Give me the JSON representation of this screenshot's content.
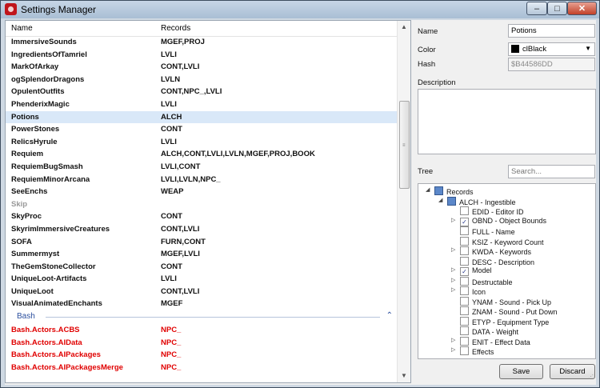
{
  "window": {
    "title": "Settings Manager",
    "controls": {
      "minimize": "–",
      "maximize": "□",
      "close": "✕"
    }
  },
  "list": {
    "columns": {
      "name": "Name",
      "records": "Records"
    },
    "rows": [
      {
        "name": "ImmersiveSounds",
        "records": "MGEF,PROJ",
        "style": "normal"
      },
      {
        "name": "IngredientsOfTamriel",
        "records": "LVLI",
        "style": "normal"
      },
      {
        "name": "MarkOfArkay",
        "records": "CONT,LVLI",
        "style": "normal"
      },
      {
        "name": "ogSplendorDragons",
        "records": "LVLN",
        "style": "normal"
      },
      {
        "name": "OpulentOutfits",
        "records": "CONT,NPC_,LVLI",
        "style": "normal"
      },
      {
        "name": "PhenderixMagic",
        "records": "LVLI",
        "style": "normal"
      },
      {
        "name": "Potions",
        "records": "ALCH",
        "style": "selected"
      },
      {
        "name": "PowerStones",
        "records": "CONT",
        "style": "normal"
      },
      {
        "name": "RelicsHyrule",
        "records": "LVLI",
        "style": "normal"
      },
      {
        "name": "Requiem",
        "records": "ALCH,CONT,LVLI,LVLN,MGEF,PROJ,BOOK",
        "style": "normal"
      },
      {
        "name": "RequiemBugSmash",
        "records": "LVLI,CONT",
        "style": "normal"
      },
      {
        "name": "RequiemMinorArcana",
        "records": "LVLI,LVLN,NPC_",
        "style": "normal"
      },
      {
        "name": "SeeEnchs",
        "records": "WEAP",
        "style": "normal"
      },
      {
        "name": "Skip",
        "records": "",
        "style": "gray"
      },
      {
        "name": "SkyProc",
        "records": "CONT",
        "style": "normal"
      },
      {
        "name": "SkyrimImmersiveCreatures",
        "records": "CONT,LVLI",
        "style": "normal"
      },
      {
        "name": "SOFA",
        "records": "FURN,CONT",
        "style": "normal"
      },
      {
        "name": "Summermyst",
        "records": "MGEF,LVLI",
        "style": "normal"
      },
      {
        "name": "TheGemStoneCollector",
        "records": "CONT",
        "style": "normal"
      },
      {
        "name": "UniqueLoot-Artifacts",
        "records": "LVLI",
        "style": "normal"
      },
      {
        "name": "UniqueLoot",
        "records": "CONT,LVLI",
        "style": "normal"
      },
      {
        "name": "VisualAnimatedEnchants",
        "records": "MGEF",
        "style": "normal"
      }
    ],
    "group": {
      "label": "Bash",
      "chevron": "⌃"
    },
    "group_rows": [
      {
        "name": "Bash.Actors.ACBS",
        "records": "NPC_",
        "style": "red"
      },
      {
        "name": "Bash.Actors.AIData",
        "records": "NPC_",
        "style": "red"
      },
      {
        "name": "Bash.Actors.AIPackages",
        "records": "NPC_",
        "style": "red"
      },
      {
        "name": "Bash.Actors.AIPackagesMerge",
        "records": "NPC_",
        "style": "red"
      }
    ]
  },
  "details": {
    "name_label": "Name",
    "name_value": "Potions",
    "color_label": "Color",
    "color_value": "clBlack",
    "hash_label": "Hash",
    "hash_value": "$B44586DD",
    "description_label": "Description",
    "tree_label": "Tree",
    "search_placeholder": "Search..."
  },
  "tree": {
    "root": "Records",
    "child": "ALCH - Ingestible",
    "items": [
      {
        "label": "EDID - Editor ID",
        "checked": false,
        "expandable": false
      },
      {
        "label": "OBND - Object Bounds",
        "checked": true,
        "expandable": true
      },
      {
        "label": "FULL - Name",
        "checked": false,
        "expandable": false
      },
      {
        "label": "KSIZ - Keyword Count",
        "checked": false,
        "expandable": false
      },
      {
        "label": "KWDA - Keywords",
        "checked": false,
        "expandable": true
      },
      {
        "label": "DESC - Description",
        "checked": false,
        "expandable": false
      },
      {
        "label": "Model",
        "checked": true,
        "expandable": true
      },
      {
        "label": "Destructable",
        "checked": false,
        "expandable": true
      },
      {
        "label": "Icon",
        "checked": false,
        "expandable": true
      },
      {
        "label": "YNAM - Sound - Pick Up",
        "checked": false,
        "expandable": false
      },
      {
        "label": "ZNAM - Sound - Put Down",
        "checked": false,
        "expandable": false
      },
      {
        "label": "ETYP - Equipment Type",
        "checked": false,
        "expandable": false
      },
      {
        "label": "DATA - Weight",
        "checked": false,
        "expandable": false
      },
      {
        "label": "ENIT - Effect Data",
        "checked": false,
        "expandable": true
      },
      {
        "label": "Effects",
        "checked": false,
        "expandable": true
      }
    ]
  },
  "buttons": {
    "save": "Save",
    "discard": "Discard"
  },
  "colors": {
    "selection": "#d9e8f8",
    "red_text": "#e00000",
    "group_text": "#2b4f9e"
  }
}
